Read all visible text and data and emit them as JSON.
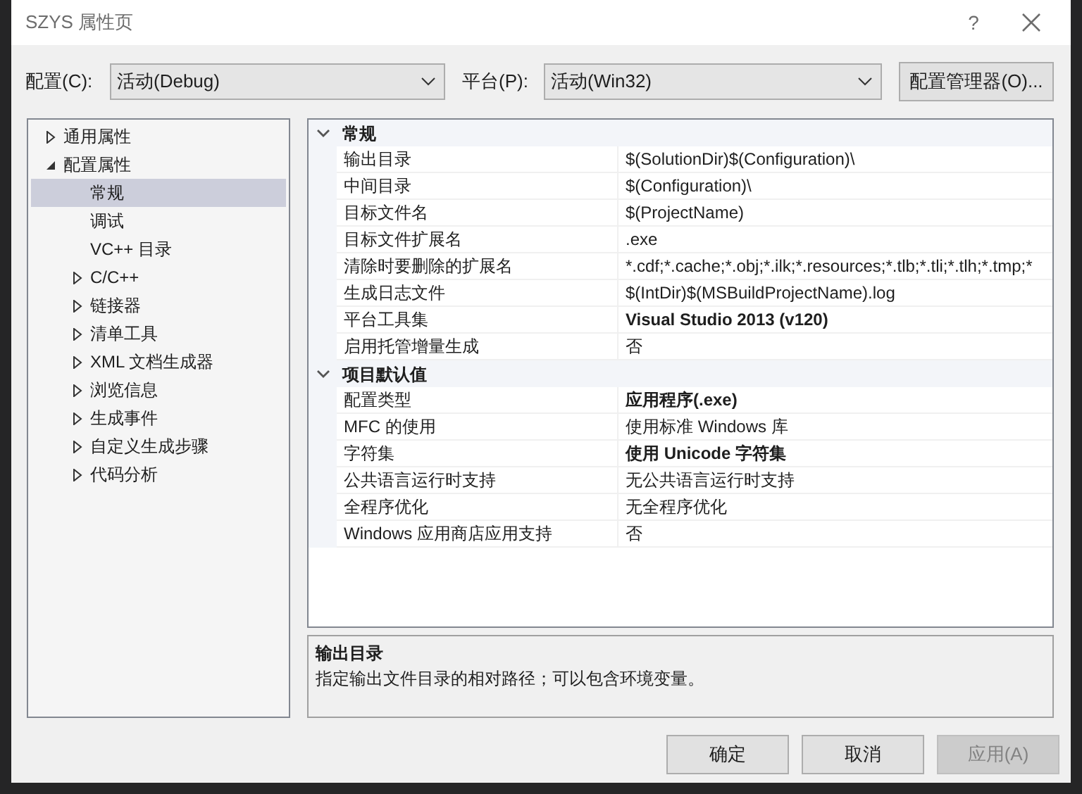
{
  "window": {
    "title": "SZYS 属性页",
    "help": "?"
  },
  "toolbar": {
    "config_label": "配置(C):",
    "config_value": "活动(Debug)",
    "platform_label": "平台(P):",
    "platform_value": "活动(Win32)",
    "manager_button": "配置管理器(O)..."
  },
  "tree": [
    {
      "label": "通用属性",
      "expanded": false,
      "selected": false
    },
    {
      "label": "配置属性",
      "expanded": true,
      "selected": false,
      "children": [
        {
          "label": "常规",
          "selected": true
        },
        {
          "label": "调试",
          "selected": false
        },
        {
          "label": "VC++ 目录",
          "selected": false
        },
        {
          "label": "C/C++",
          "expanded": false,
          "selected": false
        },
        {
          "label": "链接器",
          "expanded": false,
          "selected": false
        },
        {
          "label": "清单工具",
          "expanded": false,
          "selected": false
        },
        {
          "label": "XML 文档生成器",
          "expanded": false,
          "selected": false
        },
        {
          "label": "浏览信息",
          "expanded": false,
          "selected": false
        },
        {
          "label": "生成事件",
          "expanded": false,
          "selected": false
        },
        {
          "label": "自定义生成步骤",
          "expanded": false,
          "selected": false
        },
        {
          "label": "代码分析",
          "expanded": false,
          "selected": false
        }
      ]
    }
  ],
  "grid": [
    {
      "title": "常规",
      "expanded": true,
      "rows": [
        {
          "name": "输出目录",
          "value": "$(SolutionDir)$(Configuration)\\",
          "bold": false
        },
        {
          "name": "中间目录",
          "value": "$(Configuration)\\",
          "bold": false
        },
        {
          "name": "目标文件名",
          "value": "$(ProjectName)",
          "bold": false
        },
        {
          "name": "目标文件扩展名",
          "value": ".exe",
          "bold": false
        },
        {
          "name": "清除时要删除的扩展名",
          "value": "*.cdf;*.cache;*.obj;*.ilk;*.resources;*.tlb;*.tli;*.tlh;*.tmp;*",
          "bold": false
        },
        {
          "name": "生成日志文件",
          "value": "$(IntDir)$(MSBuildProjectName).log",
          "bold": false
        },
        {
          "name": "平台工具集",
          "value": "Visual Studio 2013 (v120)",
          "bold": true
        },
        {
          "name": "启用托管增量生成",
          "value": "否",
          "bold": false
        }
      ]
    },
    {
      "title": "项目默认值",
      "expanded": true,
      "rows": [
        {
          "name": "配置类型",
          "value": "应用程序(.exe)",
          "bold": true
        },
        {
          "name": "MFC 的使用",
          "value": "使用标准 Windows 库",
          "bold": false
        },
        {
          "name": "字符集",
          "value": "使用 Unicode 字符集",
          "bold": true
        },
        {
          "name": "公共语言运行时支持",
          "value": "无公共语言运行时支持",
          "bold": false
        },
        {
          "name": "全程序优化",
          "value": "无全程序优化",
          "bold": false
        },
        {
          "name": "Windows 应用商店应用支持",
          "value": "否",
          "bold": false
        }
      ]
    }
  ],
  "description": {
    "title": "输出目录",
    "text": "指定输出文件目录的相对路径；可以包含环境变量。"
  },
  "buttons": [
    {
      "label": "确定",
      "disabled": false
    },
    {
      "label": "取消",
      "disabled": false
    },
    {
      "label": "应用(A)",
      "disabled": true
    }
  ]
}
